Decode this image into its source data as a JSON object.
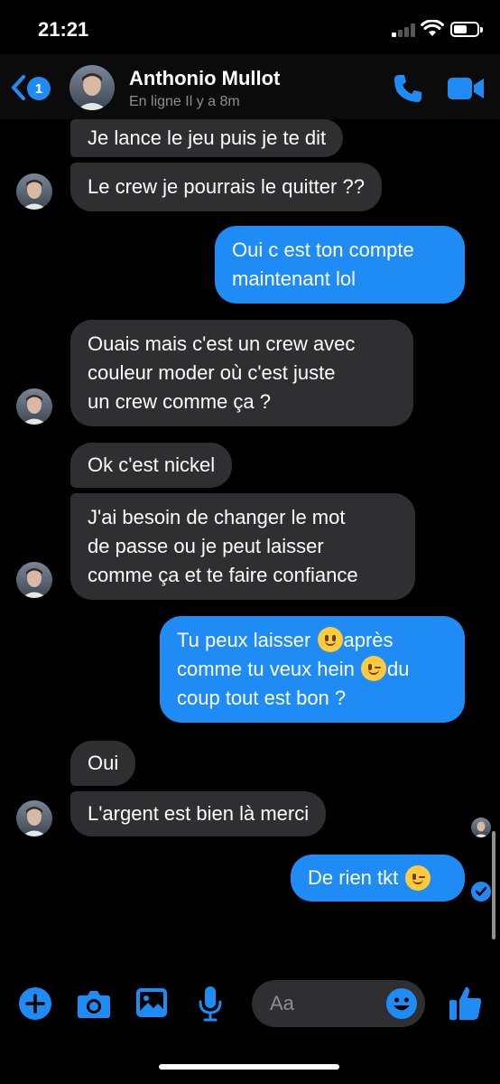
{
  "status_bar": {
    "time": "21:21"
  },
  "header": {
    "unread_count": "1",
    "contact_name": "Anthonio Mullot",
    "presence": "En ligne Il y a 8m"
  },
  "messages": [
    {
      "from": "contact",
      "text": "Je lance le jeu puis je te dit"
    },
    {
      "from": "contact",
      "text": "Le crew je pourrais le quitter ??"
    },
    {
      "from": "me",
      "lines": [
        "Oui c est ton compte",
        "maintenant lol"
      ]
    },
    {
      "from": "contact",
      "lines": [
        "Ouais mais c'est un crew avec",
        "couleur moder où c'est juste",
        "un crew comme ça ?"
      ]
    },
    {
      "from": "contact",
      "text": "Ok c'est nickel"
    },
    {
      "from": "contact",
      "lines": [
        "J'ai besoin de changer le mot",
        "de passe ou je peut laisser",
        "comme ça et te faire confiance"
      ]
    },
    {
      "from": "me",
      "parts": [
        "Tu peux laisser",
        "après",
        "comme tu veux hein",
        "du",
        "coup tout est bon ?"
      ],
      "emojis": [
        "slightly-smiling-face",
        "winking-face"
      ]
    },
    {
      "from": "contact",
      "text": "Oui"
    },
    {
      "from": "contact",
      "text": "L'argent est bien là merci"
    },
    {
      "from": "me",
      "text": "De rien tkt",
      "emojis": [
        "winking-face"
      ]
    }
  ],
  "composer": {
    "placeholder": "Aa"
  },
  "icons": {
    "back": "chevron-left-icon",
    "call": "phone-icon",
    "video": "video-camera-icon",
    "add": "plus-circle-icon",
    "camera": "camera-icon",
    "gallery": "image-icon",
    "voice": "microphone-icon",
    "emoji": "smiley-icon",
    "like": "thumbs-up-icon",
    "seen": "check-circle-icon"
  },
  "colors": {
    "accent": "#1f8cf6",
    "received_bubble": "#2f2f31",
    "background": "#000000"
  }
}
